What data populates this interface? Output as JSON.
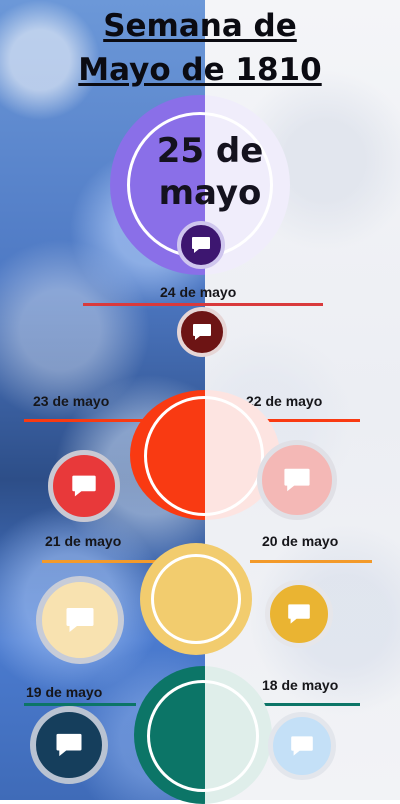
{
  "title": {
    "line1": "Semana de",
    "line2": "Mayo de 1810"
  },
  "main_date": {
    "line1": "25 de",
    "line2": "mayo"
  },
  "dates": [
    {
      "label": "24 de mayo"
    },
    {
      "label": "23 de mayo"
    },
    {
      "label": "22 de mayo"
    },
    {
      "label": "21 de mayo"
    },
    {
      "label": "20 de mayo"
    },
    {
      "label": "19 de mayo"
    },
    {
      "label": "18 de mayo"
    }
  ],
  "colors": {
    "purple": "#8a6fe8",
    "purple_light": "#f0edfb",
    "purple_dark": "#3d1670",
    "red_line": "#d93a3c",
    "maroon": "#6d1414",
    "orange_red": "#f93a12",
    "pink_light": "#fde4e1",
    "red_badge": "#e8393a",
    "pink_badge": "#f4b8b6",
    "yellow": "#f2cc6e",
    "cream": "#f8e2b0",
    "mustard": "#eab432",
    "orange_line": "#f39a2a",
    "teal": "#0c7567",
    "teal_light": "#dfeeea",
    "navy": "#153e5c",
    "sky": "#c4e0f7"
  },
  "icons": [
    "chat-bubble-icon"
  ]
}
